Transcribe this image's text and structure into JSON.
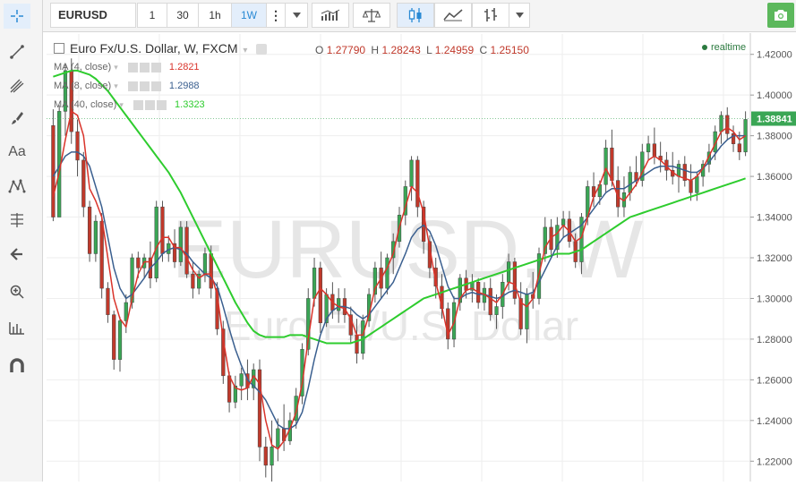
{
  "toolbar": {
    "symbol": "EURUSD",
    "intervals": [
      "1",
      "30",
      "1h",
      "1W"
    ],
    "active_interval": "1W"
  },
  "chart_header": {
    "title": "Euro Fx/U.S. Dollar, W, FXCM",
    "open_label": "O",
    "open": "1.27790",
    "high_label": "H",
    "high": "1.28243",
    "low_label": "L",
    "low": "1.24959",
    "close_label": "C",
    "close": "1.25150",
    "realtime": "realtime"
  },
  "indicators": [
    {
      "label": "MA (4, close)",
      "value": "1.2821",
      "color": "#d9342b"
    },
    {
      "label": "MA (8, close)",
      "value": "1.2988",
      "color": "#3a5f8f"
    },
    {
      "label": "MA (40, close)",
      "value": "1.3323",
      "color": "#2ecc2e"
    }
  ],
  "watermark": {
    "symbol": "EURUSD, W",
    "description": "Euro Fx/U.S. Dollar"
  },
  "colors": {
    "up": "#3aa655",
    "down": "#c0392b",
    "price_tag": "#3aa655"
  },
  "chart_data": {
    "type": "candlestick",
    "title": "Euro Fx/U.S. Dollar, W, FXCM",
    "ylim": [
      1.21,
      1.43
    ],
    "y_ticks": [
      "1.42000",
      "1.40000",
      "1.38000",
      "1.36000",
      "1.34000",
      "1.32000",
      "1.30000",
      "1.28000",
      "1.26000",
      "1.24000",
      "1.22000"
    ],
    "last_price": "1.38841",
    "candles": [
      [
        1.385,
        1.393,
        1.338,
        1.34
      ],
      [
        1.34,
        1.395,
        1.34,
        1.392
      ],
      [
        1.392,
        1.415,
        1.38,
        1.412
      ],
      [
        1.412,
        1.418,
        1.376,
        1.382
      ],
      [
        1.382,
        1.388,
        1.36,
        1.368
      ],
      [
        1.368,
        1.372,
        1.34,
        1.345
      ],
      [
        1.345,
        1.348,
        1.318,
        1.322
      ],
      [
        1.322,
        1.341,
        1.318,
        1.338
      ],
      [
        1.338,
        1.342,
        1.3,
        1.305
      ],
      [
        1.305,
        1.308,
        1.288,
        1.292
      ],
      [
        1.292,
        1.294,
        1.265,
        1.27
      ],
      [
        1.27,
        1.291,
        1.264,
        1.289
      ],
      [
        1.289,
        1.302,
        1.283,
        1.298
      ],
      [
        1.298,
        1.322,
        1.295,
        1.32
      ],
      [
        1.32,
        1.323,
        1.31,
        1.315
      ],
      [
        1.315,
        1.322,
        1.31,
        1.32
      ],
      [
        1.32,
        1.328,
        1.305,
        1.31
      ],
      [
        1.31,
        1.348,
        1.308,
        1.345
      ],
      [
        1.345,
        1.348,
        1.318,
        1.322
      ],
      [
        1.322,
        1.331,
        1.318,
        1.327
      ],
      [
        1.327,
        1.334,
        1.315,
        1.318
      ],
      [
        1.318,
        1.338,
        1.316,
        1.335
      ],
      [
        1.335,
        1.338,
        1.31,
        1.312
      ],
      [
        1.312,
        1.318,
        1.3,
        1.305
      ],
      [
        1.305,
        1.314,
        1.302,
        1.312
      ],
      [
        1.312,
        1.325,
        1.308,
        1.322
      ],
      [
        1.322,
        1.326,
        1.3,
        1.305
      ],
      [
        1.305,
        1.308,
        1.282,
        1.285
      ],
      [
        1.285,
        1.289,
        1.258,
        1.262
      ],
      [
        1.262,
        1.264,
        1.244,
        1.249
      ],
      [
        1.249,
        1.262,
        1.246,
        1.257
      ],
      [
        1.257,
        1.266,
        1.25,
        1.263
      ],
      [
        1.263,
        1.27,
        1.25,
        1.256
      ],
      [
        1.256,
        1.268,
        1.25,
        1.265
      ],
      [
        1.265,
        1.27,
        1.22,
        1.227
      ],
      [
        1.227,
        1.232,
        1.212,
        1.218
      ],
      [
        1.218,
        1.24,
        1.21,
        1.227
      ],
      [
        1.227,
        1.241,
        1.22,
        1.236
      ],
      [
        1.236,
        1.248,
        1.225,
        1.23
      ],
      [
        1.23,
        1.244,
        1.228,
        1.24
      ],
      [
        1.24,
        1.256,
        1.236,
        1.252
      ],
      [
        1.252,
        1.278,
        1.248,
        1.275
      ],
      [
        1.275,
        1.305,
        1.272,
        1.3
      ],
      [
        1.3,
        1.32,
        1.296,
        1.315
      ],
      [
        1.315,
        1.318,
        1.283,
        1.288
      ],
      [
        1.288,
        1.305,
        1.286,
        1.302
      ],
      [
        1.302,
        1.308,
        1.29,
        1.294
      ],
      [
        1.294,
        1.305,
        1.288,
        1.3
      ],
      [
        1.3,
        1.305,
        1.288,
        1.292
      ],
      [
        1.292,
        1.296,
        1.278,
        1.282
      ],
      [
        1.282,
        1.29,
        1.268,
        1.273
      ],
      [
        1.273,
        1.292,
        1.27,
        1.289
      ],
      [
        1.289,
        1.305,
        1.286,
        1.302
      ],
      [
        1.302,
        1.318,
        1.298,
        1.315
      ],
      [
        1.315,
        1.323,
        1.3,
        1.305
      ],
      [
        1.305,
        1.322,
        1.302,
        1.32
      ],
      [
        1.32,
        1.332,
        1.312,
        1.328
      ],
      [
        1.328,
        1.345,
        1.325,
        1.341
      ],
      [
        1.341,
        1.358,
        1.336,
        1.355
      ],
      [
        1.355,
        1.37,
        1.348,
        1.368
      ],
      [
        1.368,
        1.37,
        1.34,
        1.345
      ],
      [
        1.345,
        1.348,
        1.322,
        1.328
      ],
      [
        1.328,
        1.331,
        1.31,
        1.315
      ],
      [
        1.315,
        1.32,
        1.3,
        1.306
      ],
      [
        1.306,
        1.312,
        1.29,
        1.295
      ],
      [
        1.295,
        1.298,
        1.275,
        1.28
      ],
      [
        1.28,
        1.301,
        1.276,
        1.298
      ],
      [
        1.298,
        1.312,
        1.294,
        1.31
      ],
      [
        1.31,
        1.314,
        1.3,
        1.304
      ],
      [
        1.304,
        1.312,
        1.298,
        1.308
      ],
      [
        1.308,
        1.31,
        1.295,
        1.298
      ],
      [
        1.298,
        1.308,
        1.294,
        1.305
      ],
      [
        1.305,
        1.31,
        1.289,
        1.292
      ],
      [
        1.292,
        1.302,
        1.285,
        1.296
      ],
      [
        1.296,
        1.312,
        1.29,
        1.308
      ],
      [
        1.308,
        1.322,
        1.304,
        1.318
      ],
      [
        1.318,
        1.32,
        1.297,
        1.3
      ],
      [
        1.3,
        1.308,
        1.282,
        1.285
      ],
      [
        1.285,
        1.305,
        1.278,
        1.302
      ],
      [
        1.302,
        1.313,
        1.295,
        1.3
      ],
      [
        1.3,
        1.325,
        1.297,
        1.322
      ],
      [
        1.322,
        1.34,
        1.318,
        1.335
      ],
      [
        1.335,
        1.339,
        1.32,
        1.324
      ],
      [
        1.324,
        1.34,
        1.32,
        1.336
      ],
      [
        1.336,
        1.343,
        1.33,
        1.339
      ],
      [
        1.339,
        1.343,
        1.325,
        1.328
      ],
      [
        1.328,
        1.332,
        1.315,
        1.318
      ],
      [
        1.318,
        1.342,
        1.312,
        1.34
      ],
      [
        1.34,
        1.358,
        1.336,
        1.355
      ],
      [
        1.355,
        1.362,
        1.345,
        1.35
      ],
      [
        1.35,
        1.358,
        1.346,
        1.356
      ],
      [
        1.356,
        1.378,
        1.352,
        1.374
      ],
      [
        1.374,
        1.383,
        1.355,
        1.358
      ],
      [
        1.358,
        1.365,
        1.34,
        1.345
      ],
      [
        1.345,
        1.36,
        1.34,
        1.352
      ],
      [
        1.352,
        1.365,
        1.348,
        1.362
      ],
      [
        1.362,
        1.37,
        1.355,
        1.358
      ],
      [
        1.358,
        1.376,
        1.355,
        1.372
      ],
      [
        1.372,
        1.38,
        1.368,
        1.376
      ],
      [
        1.376,
        1.384,
        1.366,
        1.37
      ],
      [
        1.37,
        1.377,
        1.362,
        1.368
      ],
      [
        1.368,
        1.372,
        1.358,
        1.363
      ],
      [
        1.363,
        1.372,
        1.356,
        1.36
      ],
      [
        1.36,
        1.368,
        1.352,
        1.366
      ],
      [
        1.366,
        1.37,
        1.355,
        1.358
      ],
      [
        1.358,
        1.366,
        1.348,
        1.352
      ],
      [
        1.352,
        1.362,
        1.348,
        1.36
      ],
      [
        1.36,
        1.368,
        1.355,
        1.366
      ],
      [
        1.366,
        1.376,
        1.362,
        1.372
      ],
      [
        1.372,
        1.385,
        1.368,
        1.382
      ],
      [
        1.382,
        1.392,
        1.376,
        1.39
      ],
      [
        1.39,
        1.394,
        1.378,
        1.381
      ],
      [
        1.381,
        1.385,
        1.372,
        1.376
      ],
      [
        1.376,
        1.382,
        1.368,
        1.372
      ],
      [
        1.372,
        1.392,
        1.37,
        1.388
      ]
    ],
    "ma4": [
      1.35,
      1.362,
      1.378,
      1.392,
      1.39,
      1.38,
      1.354,
      1.348,
      1.34,
      1.32,
      1.3,
      1.29,
      1.286,
      1.3,
      1.312,
      1.318,
      1.318,
      1.325,
      1.33,
      1.33,
      1.325,
      1.325,
      1.32,
      1.314,
      1.31,
      1.312,
      1.312,
      1.302,
      1.28,
      1.262,
      1.256,
      1.255,
      1.256,
      1.262,
      1.258,
      1.24,
      1.228,
      1.226,
      1.23,
      1.236,
      1.244,
      1.258,
      1.28,
      1.3,
      1.305,
      1.302,
      1.298,
      1.296,
      1.295,
      1.29,
      1.282,
      1.282,
      1.292,
      1.305,
      1.31,
      1.315,
      1.322,
      1.335,
      1.345,
      1.355,
      1.352,
      1.342,
      1.325,
      1.308,
      1.296,
      1.282,
      1.288,
      1.3,
      1.304,
      1.305,
      1.303,
      1.302,
      1.3,
      1.298,
      1.302,
      1.308,
      1.307,
      1.298,
      1.296,
      1.3,
      1.312,
      1.325,
      1.33,
      1.332,
      1.336,
      1.333,
      1.328,
      1.33,
      1.34,
      1.35,
      1.356,
      1.364,
      1.358,
      1.35,
      1.348,
      1.352,
      1.356,
      1.362,
      1.368,
      1.37,
      1.368,
      1.365,
      1.362,
      1.36,
      1.359,
      1.358,
      1.36,
      1.364,
      1.37,
      1.376,
      1.382,
      1.384,
      1.382,
      1.378,
      1.38
    ],
    "ma8": [
      1.36,
      1.365,
      1.37,
      1.372,
      1.372,
      1.37,
      1.365,
      1.355,
      1.345,
      1.33,
      1.315,
      1.305,
      1.3,
      1.302,
      1.306,
      1.31,
      1.315,
      1.318,
      1.322,
      1.324,
      1.325,
      1.324,
      1.322,
      1.318,
      1.315,
      1.312,
      1.31,
      1.306,
      1.296,
      1.285,
      1.275,
      1.267,
      1.26,
      1.257,
      1.254,
      1.25,
      1.244,
      1.238,
      1.236,
      1.236,
      1.238,
      1.244,
      1.256,
      1.27,
      1.282,
      1.29,
      1.294,
      1.296,
      1.296,
      1.295,
      1.292,
      1.29,
      1.292,
      1.296,
      1.3,
      1.304,
      1.308,
      1.315,
      1.322,
      1.33,
      1.334,
      1.336,
      1.333,
      1.326,
      1.316,
      1.306,
      1.3,
      1.3,
      1.302,
      1.303,
      1.302,
      1.302,
      1.301,
      1.3,
      1.301,
      1.303,
      1.304,
      1.303,
      1.302,
      1.303,
      1.308,
      1.314,
      1.32,
      1.326,
      1.33,
      1.332,
      1.334,
      1.336,
      1.34,
      1.344,
      1.348,
      1.352,
      1.354,
      1.354,
      1.354,
      1.356,
      1.358,
      1.36,
      1.362,
      1.364,
      1.365,
      1.365,
      1.365,
      1.364,
      1.363,
      1.362,
      1.362,
      1.364,
      1.367,
      1.371,
      1.375,
      1.378,
      1.38,
      1.38,
      1.38
    ],
    "ma40": [
      1.409,
      1.41,
      1.411,
      1.412,
      1.412,
      1.411,
      1.41,
      1.408,
      1.405,
      1.402,
      1.398,
      1.394,
      1.39,
      1.386,
      1.382,
      1.378,
      1.374,
      1.37,
      1.366,
      1.362,
      1.357,
      1.352,
      1.346,
      1.34,
      1.334,
      1.328,
      1.322,
      1.316,
      1.31,
      1.304,
      1.298,
      1.293,
      1.288,
      1.284,
      1.282,
      1.281,
      1.281,
      1.281,
      1.281,
      1.282,
      1.282,
      1.282,
      1.281,
      1.28,
      1.279,
      1.278,
      1.278,
      1.278,
      1.278,
      1.278,
      1.279,
      1.28,
      1.282,
      1.284,
      1.286,
      1.288,
      1.29,
      1.292,
      1.294,
      1.296,
      1.298,
      1.3,
      1.301,
      1.302,
      1.303,
      1.304,
      1.305,
      1.306,
      1.307,
      1.308,
      1.309,
      1.31,
      1.311,
      1.312,
      1.313,
      1.314,
      1.315,
      1.316,
      1.317,
      1.318,
      1.319,
      1.32,
      1.321,
      1.322,
      1.322,
      1.322,
      1.323,
      1.324,
      1.326,
      1.328,
      1.33,
      1.332,
      1.334,
      1.336,
      1.338,
      1.34,
      1.341,
      1.342,
      1.343,
      1.344,
      1.345,
      1.346,
      1.347,
      1.348,
      1.349,
      1.35,
      1.351,
      1.352,
      1.353,
      1.354,
      1.355,
      1.356,
      1.357,
      1.358,
      1.359
    ]
  }
}
